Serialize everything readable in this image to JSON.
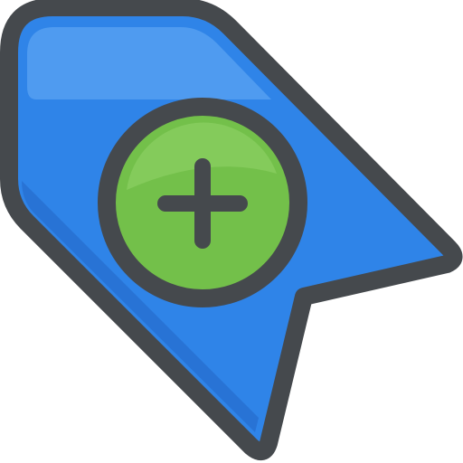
{
  "icon": {
    "name": "add-bookmark-tag-icon",
    "colors": {
      "outline": "#45494d",
      "tag_fill": "#2f84e8",
      "tag_highlight": "#6aaef5",
      "tag_shadow": "#2567c8",
      "badge_fill": "#73c04a",
      "badge_highlight": "#8fd267",
      "plus": "#45494d"
    }
  }
}
